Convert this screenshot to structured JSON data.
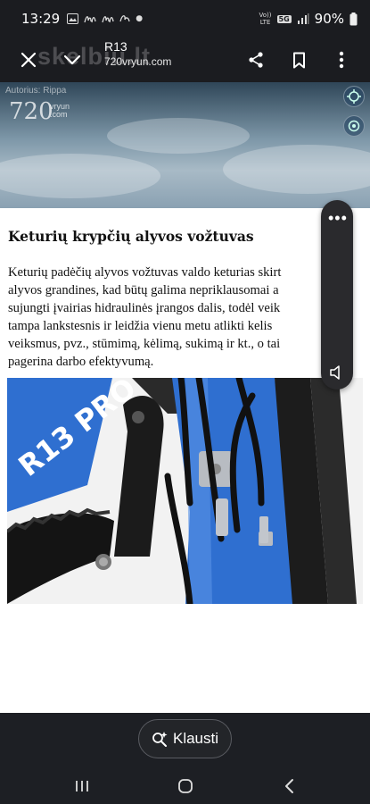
{
  "status_bar": {
    "time": "13:29",
    "network_top": "Vo))",
    "network_bottom": "LTE",
    "signal_badge": "5G",
    "battery": "90%"
  },
  "toolbar": {
    "watermark": "skelbiu.lt",
    "title": "R13",
    "subtitle": "720vryun.com"
  },
  "hero": {
    "caption": "Autorius: Rippa",
    "logo": "720",
    "logo_small_top": "vryun",
    "logo_small_bottom": ".com"
  },
  "article": {
    "title": "Keturių krypčių alyvos vožtuvas",
    "body_lines": [
      "Keturių padėčių alyvos vožtuvas valdo keturias skirt",
      "alyvos grandines, kad būtų galima nepriklausomai a",
      "sujungti įvairias hidraulinės įrangos dalis, todėl veik",
      "tampa lankstesnis ir leidžia vienu metu atlikti kelis",
      "veiksmus, pvz., stūmimą, kėlimą, sukimą ir kt., o tai",
      "pagerina darbo efektyvumą."
    ],
    "image_text": "R13 PRO"
  },
  "side_panel": {
    "menu_glyph": "•••"
  },
  "ask_button": {
    "label": "Klausti"
  },
  "colors": {
    "status_bg": "#1b1c20",
    "article_bg": "#ffffff",
    "bucket_blue": "#2f6fd0",
    "panel_bg": "#2a2a2d"
  }
}
